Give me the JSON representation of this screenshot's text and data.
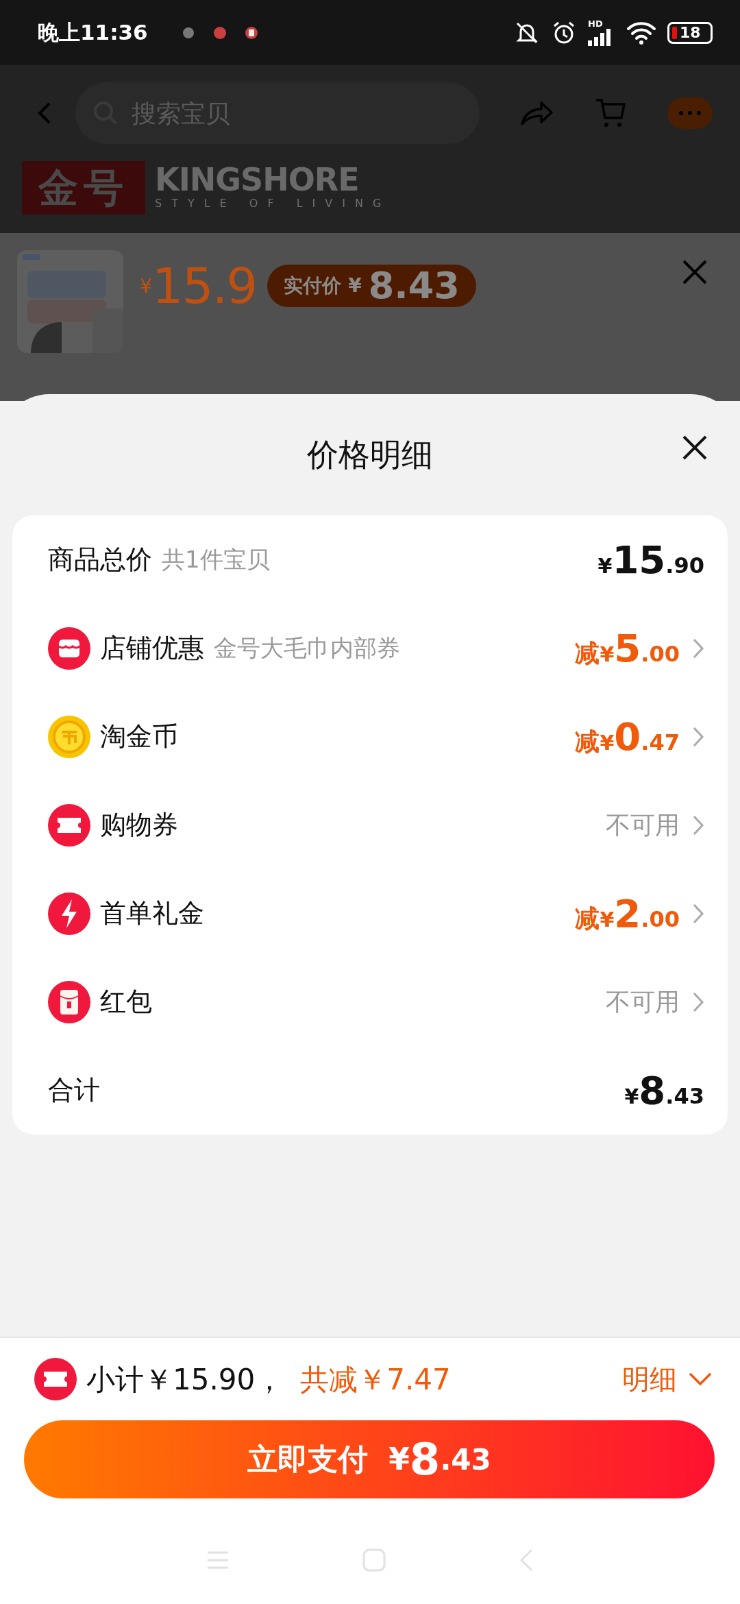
{
  "status_bar": {
    "time": "晚上11:36",
    "network": "HD",
    "battery": "18"
  },
  "top_nav": {
    "search": {
      "placeholder": "搜索宝贝"
    }
  },
  "brand": {
    "logo": "金号",
    "name": "KINGSHORE",
    "tagline": "STYLE OF LIVING"
  },
  "product": {
    "currency": "¥",
    "price": "15.9",
    "paid_label": "实付价",
    "paid_currency": "¥",
    "paid_amount": "8.43"
  },
  "sheet": {
    "title": "价格明细"
  },
  "rows": [
    {
      "kind": "total",
      "label": "商品总价",
      "note": "共1件宝贝",
      "currency": "¥",
      "integer": "15",
      "decimal": ".90"
    },
    {
      "kind": "discount",
      "label": "店铺优惠",
      "note": "金号大毛巾内部券",
      "prefix": "减",
      "currency": "¥",
      "integer": "5",
      "decimal": ".00"
    },
    {
      "kind": "discount",
      "label": "淘金币",
      "prefix": "减",
      "currency": "¥",
      "integer": "0",
      "decimal": ".47"
    },
    {
      "kind": "unavailable",
      "label": "购物券",
      "status": "不可用"
    },
    {
      "kind": "discount",
      "label": "首单礼金",
      "prefix": "减",
      "currency": "¥",
      "integer": "2",
      "decimal": ".00"
    },
    {
      "kind": "unavailable",
      "label": "红包",
      "status": "不可用"
    },
    {
      "kind": "total",
      "label": "合计",
      "currency": "¥",
      "integer": "8",
      "decimal": ".43"
    }
  ],
  "summary": {
    "subtotal": "小计￥15.90，",
    "reduced": "共减￥7.47",
    "detail": "明细",
    "expanded": false
  },
  "pay_button": {
    "label": "立即支付",
    "currency": "¥",
    "integer": "8",
    "decimal": ".43"
  }
}
